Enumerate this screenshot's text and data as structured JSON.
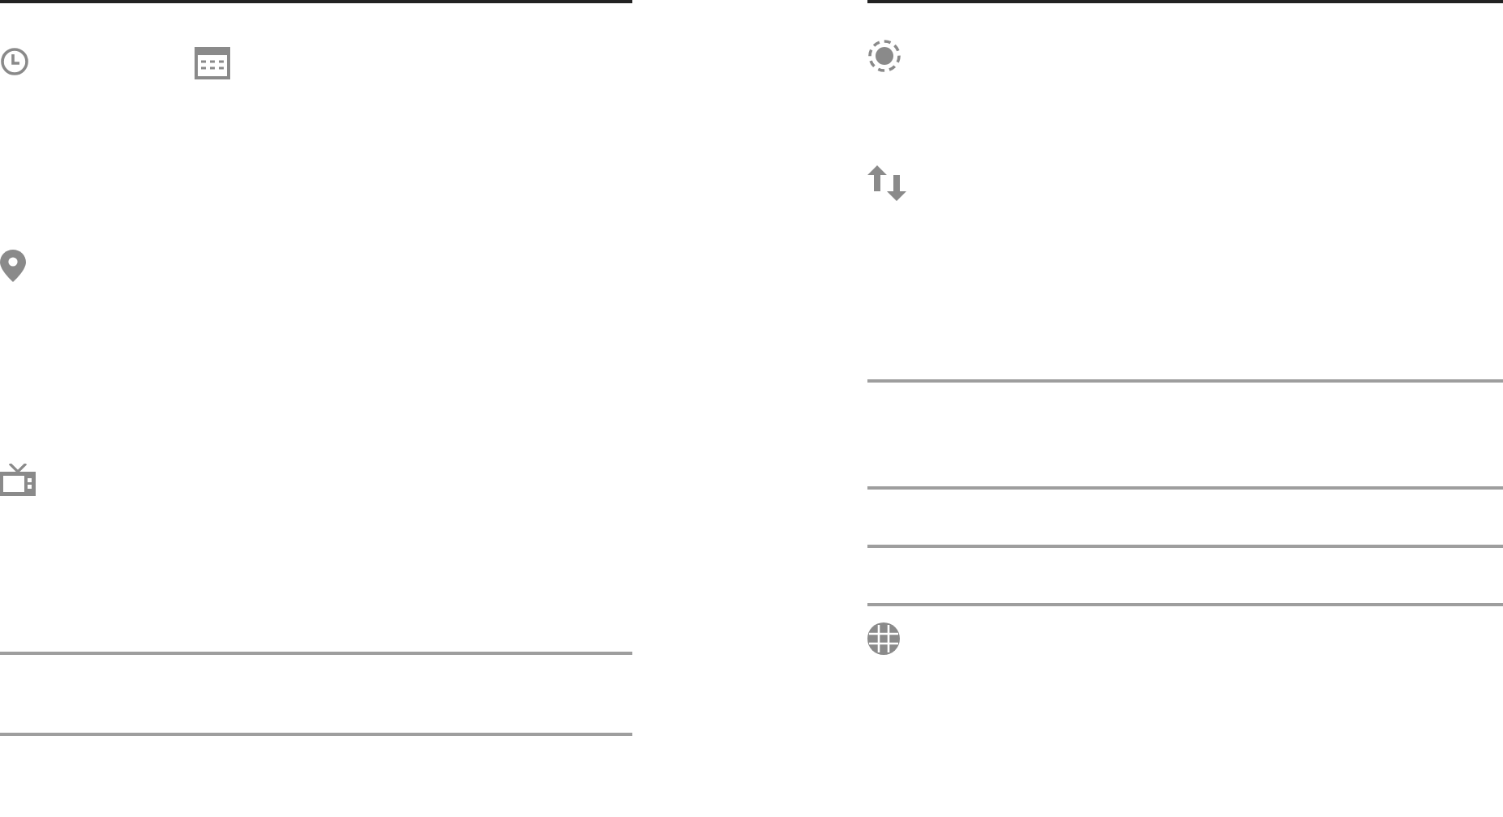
{
  "left_column": {
    "sections": [
      {
        "kind": "clock-calendar"
      },
      {
        "kind": "location"
      },
      {
        "kind": "tv"
      },
      {
        "kind": "blank"
      },
      {
        "kind": "blank"
      }
    ]
  },
  "right_column": {
    "sections": [
      {
        "kind": "brightness"
      },
      {
        "kind": "data-transfer"
      },
      {
        "kind": "blank"
      },
      {
        "kind": "blank"
      },
      {
        "kind": "blank"
      },
      {
        "kind": "globe"
      }
    ]
  }
}
